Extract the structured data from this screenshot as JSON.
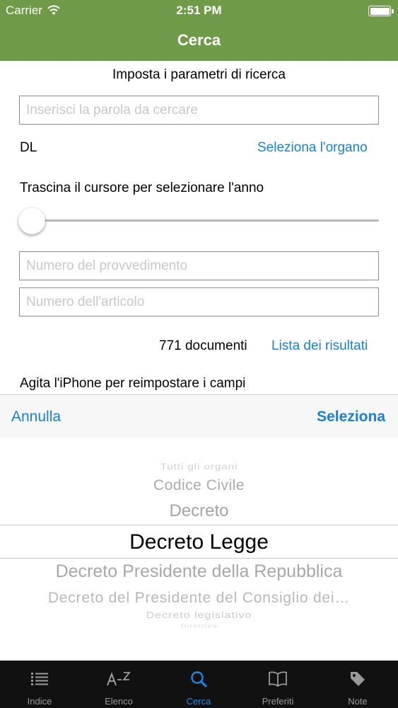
{
  "status_bar": {
    "carrier": "Carrier",
    "time": "2:51 PM",
    "wifi_icon": "wifi-icon",
    "battery_icon": "battery-icon",
    "battery_level": 1.0
  },
  "nav": {
    "title": "Cerca"
  },
  "form": {
    "subtitle": "Imposta i parametri di ricerca",
    "search_placeholder": "Inserisci la parola da cercare",
    "search_value": "",
    "organ_value": "DL",
    "organ_link": "Seleziona l'organo",
    "year_label": "Trascina il cursore per selezionare l'anno",
    "year_slider_value": 0.0,
    "number_placeholder": "Numero del provvedimento",
    "article_placeholder": "Numero dell'articolo",
    "documents_count": "771 documenti",
    "results_link": "Lista dei risultati",
    "shake_hint": "Agita l'iPhone per reimpostare i campi"
  },
  "picker": {
    "cancel_label": "Annulla",
    "select_label": "Seleziona",
    "options": [
      "Tutti gli organi",
      "Codice Civile",
      "Decreto",
      "Decreto Legge",
      "Decreto Presidente della Repubblica",
      "Decreto del Presidente del Consiglio dei…",
      "Decreto legislativo",
      "Direttiva"
    ],
    "selected": "Decreto Legge"
  },
  "tab_bar": {
    "active": "Cerca",
    "items": [
      {
        "label": "Indice",
        "icon": "list-icon"
      },
      {
        "label": "Elenco",
        "icon": "az-sort-icon"
      },
      {
        "label": "Cerca",
        "icon": "search-icon"
      },
      {
        "label": "Preferiti",
        "icon": "book-icon"
      },
      {
        "label": "Note",
        "icon": "tag-icon"
      }
    ]
  },
  "colors": {
    "bar_green": "#6f9a47",
    "link_blue": "#1a7fd6",
    "tab_active": "#1a8ce8",
    "tab_bg": "#111111"
  }
}
